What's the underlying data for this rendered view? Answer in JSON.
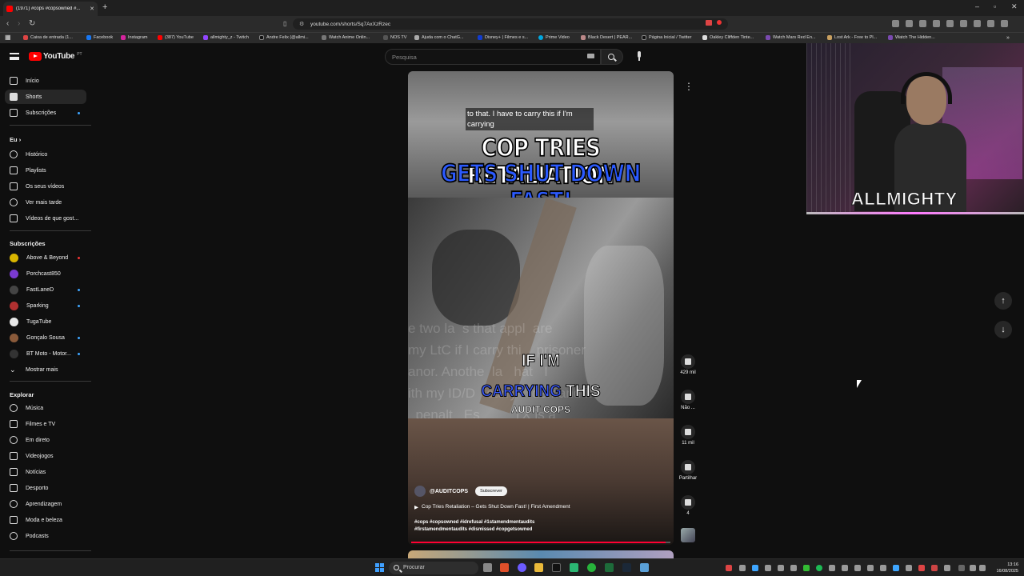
{
  "browser": {
    "tab_title": "(1971) #cops #copsowned #...",
    "url": "youtube.com/shorts/Sq7AxXzRzec",
    "bookmarks": [
      "Caixa de entrada (1...",
      "Facebook",
      "Instagram",
      "(387) YouTube",
      "allmighty_z - Twitch",
      "Andre Felix (@allmi...",
      "Watch Anime Onlin...",
      "NOS TV",
      "Ajuda com o ChatG...",
      "Disney+ | Filmes e s...",
      "Prime Video",
      "Black Desert | PEAR...",
      "Página Inicial / Twitter",
      "Oakley Cliffden Tinte...",
      "Watch Mars Red En...",
      "Lost Ark - Free to Pl...",
      "Watch The Hidden..."
    ]
  },
  "youtube": {
    "logo_text": "YouTube",
    "logo_region": "PT",
    "search_placeholder": "Pesquisa"
  },
  "sidebar": {
    "main": [
      {
        "label": "Início",
        "icon": "home-icon"
      },
      {
        "label": "Shorts",
        "icon": "shorts-icon"
      },
      {
        "label": "Subscrições",
        "icon": "subscriptions-icon"
      }
    ],
    "you_heading": "Eu",
    "you": [
      {
        "label": "Histórico",
        "icon": "history-icon"
      },
      {
        "label": "Playlists",
        "icon": "playlist-icon"
      },
      {
        "label": "Os seus vídeos",
        "icon": "video-icon"
      },
      {
        "label": "Ver mais tarde",
        "icon": "clock-icon"
      },
      {
        "label": "Vídeos de que gost...",
        "icon": "like-icon"
      }
    ],
    "subs_heading": "Subscrições",
    "subs": [
      {
        "label": "Above & Beyond",
        "color": "#d9b500"
      },
      {
        "label": "Porchcast850",
        "color": "#7a3ad0"
      },
      {
        "label": "FastLaneD",
        "color": "#444444"
      },
      {
        "label": "Sparking",
        "color": "#b03030"
      },
      {
        "label": "TugaTube",
        "color": "#e8e8e8"
      },
      {
        "label": "Gonçalo Sousa",
        "color": "#8a5a3a"
      },
      {
        "label": "BT Moto - Motor...",
        "color": "#333333"
      },
      {
        "label": "Mostrar mais",
        "color": ""
      }
    ],
    "explore_heading": "Explorar",
    "explore": [
      {
        "label": "Música",
        "icon": "music-icon"
      },
      {
        "label": "Filmes e TV",
        "icon": "film-icon"
      },
      {
        "label": "Em direto",
        "icon": "live-icon"
      },
      {
        "label": "Videojogos",
        "icon": "gamepad-icon"
      },
      {
        "label": "Notícias",
        "icon": "news-icon"
      },
      {
        "label": "Desporto",
        "icon": "trophy-icon"
      },
      {
        "label": "Aprendizagem",
        "icon": "bulb-icon"
      },
      {
        "label": "Moda e beleza",
        "icon": "hanger-icon"
      },
      {
        "label": "Podcasts",
        "icon": "podcast-icon"
      }
    ]
  },
  "short": {
    "top_caption": "to that. I have to carry this if I'm carrying",
    "headline_1": "COP TRIES RETALIATION",
    "headline_2": "GETS SHUT DOWN FAST!",
    "ghost_text": "e two la  s that appl  are\nmy LtC if I carry thi    prisoner\nanor. Anothe  la   hat   I\nith my ID/D   carry    demand it\n  penalt   Es         TX is a",
    "caption_1": "IF I'M",
    "caption_2a": "CARRYING",
    "caption_2b": " THIS",
    "caption_3": "AUDIT COPS",
    "channel": "@AUDITCOPS",
    "subscribe": "Subscrever",
    "title": "Cop Tries Retaliation – Gets Shut Down Fast! | First Amendment",
    "hashtags": "#cops #copsowned #idrefusal #1stamendmentaudits #firstamendmentaudits #dismissed #copgetsowned",
    "progress": 0.98
  },
  "actions": {
    "like_count": "429 mil",
    "dislike_label": "Não ...",
    "comments_count": "11 mil",
    "share_label": "Partilhar",
    "remix_count": "4"
  },
  "webcam": {
    "name": "ALLMIGHTY"
  },
  "taskbar": {
    "search": "Procurar",
    "time": "13:16",
    "date": "16/08/2025"
  }
}
